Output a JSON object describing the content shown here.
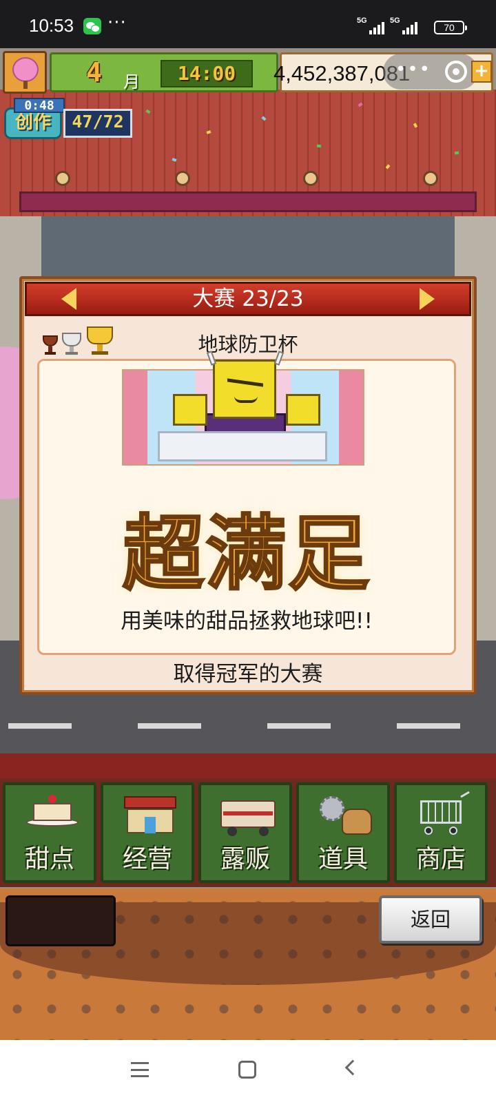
{
  "status_bar": {
    "time": "10:53",
    "dots": "···",
    "signal1_label": "5G",
    "signal2_label": "5G",
    "battery": "70"
  },
  "hud": {
    "month_number": "4",
    "month_label": "月",
    "clock": "14:00",
    "money": "4,452,387,081",
    "plus": "+",
    "create_timer": "0:48",
    "create_label": "创作",
    "create_count": "47/72"
  },
  "panel": {
    "header": "大赛 23/23",
    "cup_name": "地球防卫杯",
    "result": "超满足",
    "description": "用美味的甜品拯救地球吧!!",
    "footer": "取得冠军的大赛"
  },
  "menu": {
    "items": [
      {
        "label": "甜点",
        "icon": "cake-icon"
      },
      {
        "label": "经营",
        "icon": "shop-icon"
      },
      {
        "label": "露贩",
        "icon": "food-truck-icon"
      },
      {
        "label": "道具",
        "icon": "tools-bag-icon"
      },
      {
        "label": "商店",
        "icon": "cart-icon"
      }
    ]
  },
  "back_button": "返回",
  "colors": {
    "panel_header": "#c0301f",
    "menu_button": "#3f6f2f",
    "result_text": "#f2a53a"
  }
}
